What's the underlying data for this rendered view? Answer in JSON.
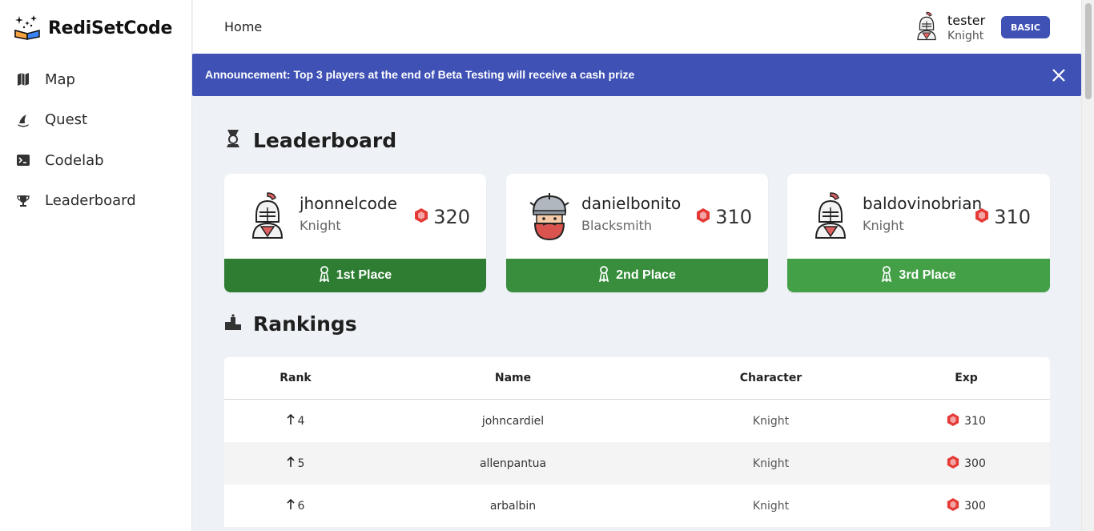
{
  "app": {
    "name": "RediSetCode"
  },
  "sidebar": {
    "items": [
      {
        "label": "Map",
        "icon": "map-icon"
      },
      {
        "label": "Quest",
        "icon": "quest-icon"
      },
      {
        "label": "Codelab",
        "icon": "terminal-icon"
      },
      {
        "label": "Leaderboard",
        "icon": "trophy-icon"
      }
    ]
  },
  "header": {
    "breadcrumb": "Home",
    "user": {
      "name": "tester",
      "role": "Knight"
    },
    "plan": "BASIC"
  },
  "announcement": {
    "text": "Announcement: Top 3 players at the end of Beta Testing will receive a cash prize"
  },
  "leaderboard": {
    "title": "Leaderboard",
    "podium": [
      {
        "name": "jhonnelcode",
        "role": "Knight",
        "exp": "320",
        "place": "1st Place",
        "color": "#2e7d32",
        "avatar": "knight-avatar"
      },
      {
        "name": "danielbonito",
        "role": "Blacksmith",
        "exp": "310",
        "place": "2nd Place",
        "color": "#388e3c",
        "avatar": "blacksmith-avatar"
      },
      {
        "name": "baldovinobrian",
        "role": "Knight",
        "exp": "310",
        "place": "3rd Place",
        "color": "#43a047",
        "avatar": "knight-avatar"
      }
    ]
  },
  "rankings": {
    "title": "Rankings",
    "columns": [
      "Rank",
      "Name",
      "Character",
      "Exp"
    ],
    "rows": [
      {
        "rank": "4",
        "name": "johncardiel",
        "character": "Knight",
        "exp": "310"
      },
      {
        "rank": "5",
        "name": "allenpantua",
        "character": "Knight",
        "exp": "300"
      },
      {
        "rank": "6",
        "name": "arbalbin",
        "character": "Knight",
        "exp": "300"
      }
    ]
  },
  "colors": {
    "accent": "#3f51b5",
    "exp_badge": "#e53935"
  }
}
